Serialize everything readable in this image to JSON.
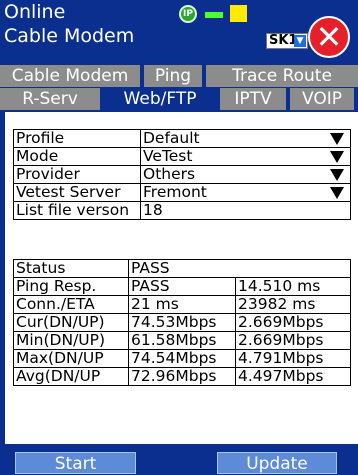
{
  "header": {
    "status": "Online",
    "device": "Cable Modem",
    "ip_badge": "IP",
    "selector": "SK1",
    "close_glyph": "✕",
    "colors": {
      "background": "#0a2f8f",
      "ip": "#2fa52f",
      "bar": "#4cff2e",
      "box": "#ffea00",
      "close": "#e6202a"
    }
  },
  "tabs_top": [
    {
      "label": "Cable Modem"
    },
    {
      "label": "Ping"
    },
    {
      "label": "Trace Route"
    }
  ],
  "tabs_sub": [
    {
      "label": "R-Serv"
    },
    {
      "label": "Web/FTP",
      "active": true
    },
    {
      "label": "IPTV"
    },
    {
      "label": "VOIP"
    }
  ],
  "config": {
    "rows": [
      {
        "label": "Profile",
        "value": "Default",
        "dropdown": true
      },
      {
        "label": "Mode",
        "value": "VeTest",
        "dropdown": true
      },
      {
        "label": "Provider",
        "value": "Others",
        "dropdown": true
      },
      {
        "label": "Vetest Server",
        "value": "Fremont",
        "dropdown": true
      },
      {
        "label": "List file verson",
        "value": "18",
        "dropdown": false
      }
    ]
  },
  "results": {
    "status_label": "Status",
    "status_value": "PASS",
    "rows": [
      {
        "label": "Ping Resp.",
        "v1": "PASS",
        "v2": "14.510 ms"
      },
      {
        "label": "Conn./ETA",
        "v1": "21 ms",
        "v2": "23982 ms"
      },
      {
        "label": "Cur(DN/UP)",
        "v1": "74.53Mbps",
        "v2": "2.669Mbps"
      },
      {
        "label": "Min(DN/UP)",
        "v1": "61.58Mbps",
        "v2": "2.669Mbps"
      },
      {
        "label": "Max(DN/UP",
        "v1": "74.54Mbps",
        "v2": "4.791Mbps"
      },
      {
        "label": "Avg(DN/UP",
        "v1": "72.96Mbps",
        "v2": "4.497Mbps"
      }
    ]
  },
  "buttons": {
    "start": "Start",
    "update": "Update"
  }
}
